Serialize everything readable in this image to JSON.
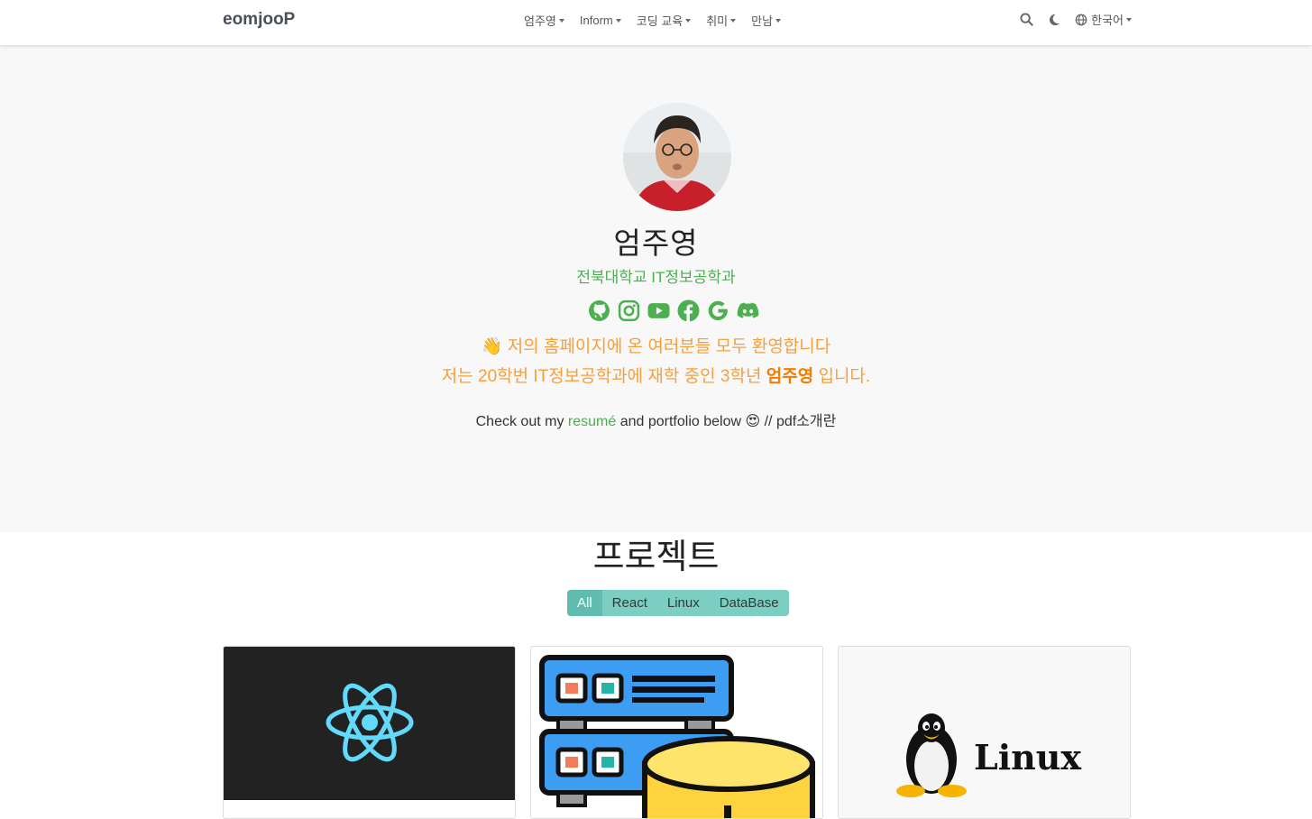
{
  "nav": {
    "brand": "eomjooP",
    "menu": [
      {
        "label": "엄주영"
      },
      {
        "label": "Inform"
      },
      {
        "label": "코딩 교육"
      },
      {
        "label": "취미"
      },
      {
        "label": "만남"
      }
    ],
    "language": "한국어"
  },
  "hero": {
    "name": "엄주영",
    "affiliation": "전북대학교 IT정보공학과",
    "socials": [
      "github-icon",
      "instagram-icon",
      "youtube-icon",
      "facebook-icon",
      "google-icon",
      "discord-icon"
    ],
    "greeting_emoji": "👋",
    "greeting_line1": "저의 홈페이지에 온 여러분들 모두 환영합니다",
    "greeting_line2_prefix": "저는 20학번 IT정보공학과에 재학 중인 3학년",
    "greeting_line2_name": "엄주영",
    "greeting_line2_suffix": "입니다.",
    "check_prefix": "Check out my",
    "check_link": "resumé",
    "check_mid": "and portfolio below",
    "check_emoji": "😍",
    "check_suffix": "// pdf소개란"
  },
  "projects": {
    "title": "프로젝트",
    "filters": [
      "All",
      "React",
      "Linux",
      "DataBase"
    ],
    "active_filter": "All",
    "cards": [
      {
        "image": "react-logo"
      },
      {
        "image": "database-icon"
      },
      {
        "image": "linux-logo",
        "logo_text": "Linux"
      }
    ]
  },
  "colors": {
    "accent_green": "#4caf50",
    "greeting_orange": "#f5a03d",
    "filter_teal": "#7ccdc2"
  }
}
